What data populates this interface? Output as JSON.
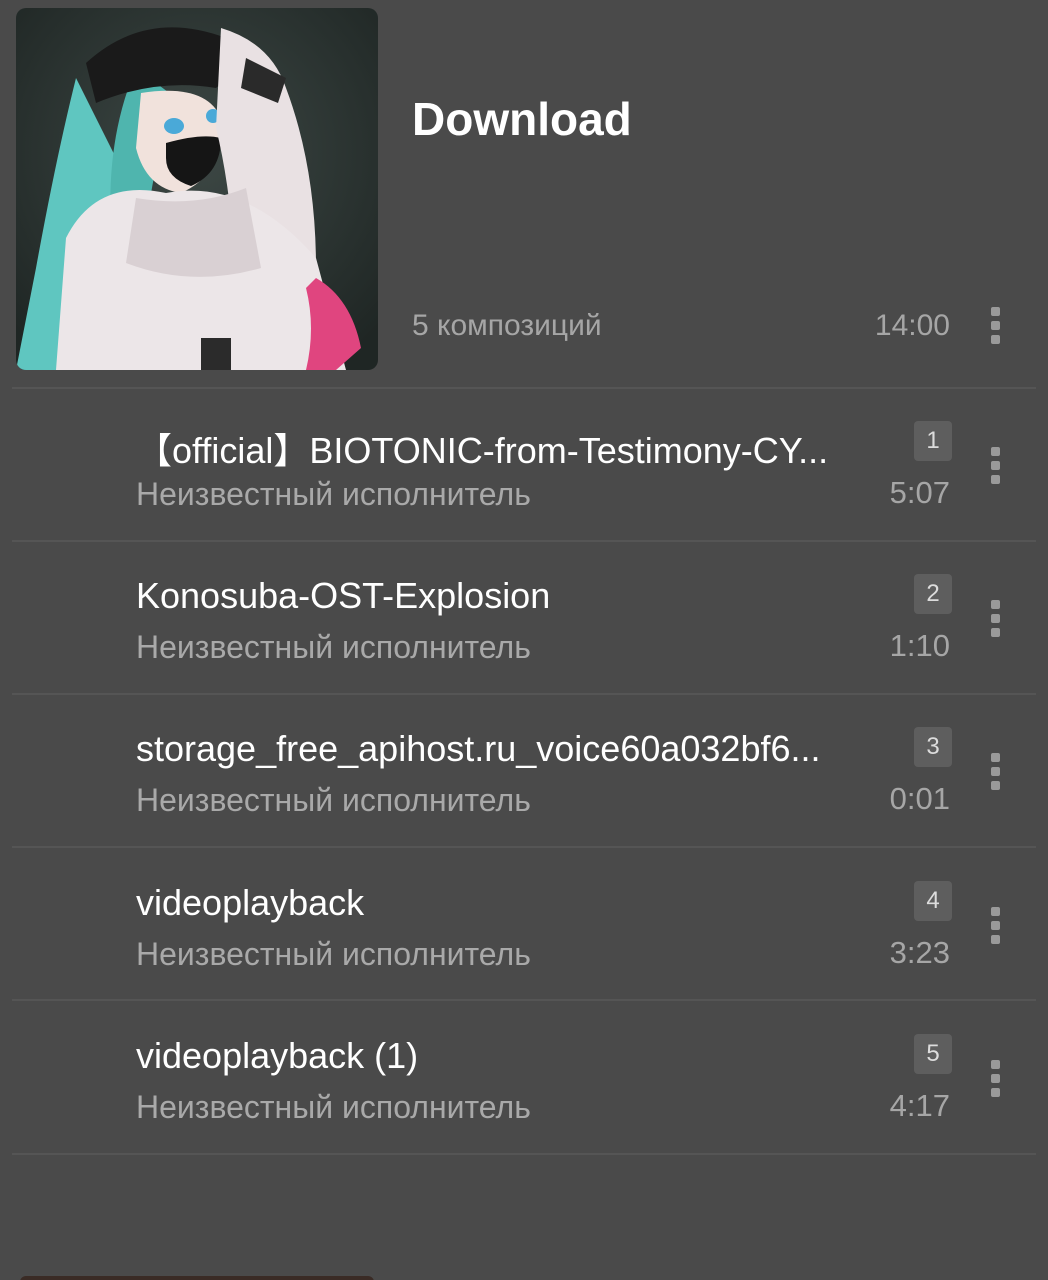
{
  "album": {
    "title": "Download",
    "count_label": "5 композиций",
    "total_duration": "14:00"
  },
  "tracks": [
    {
      "number": "1",
      "title": "【official】BIOTONIC-from-Testimony-CY...",
      "artist": "Неизвестный исполнитель",
      "duration": "5:07"
    },
    {
      "number": "2",
      "title": "Konosuba-OST-Explosion",
      "artist": "Неизвестный исполнитель",
      "duration": "1:10"
    },
    {
      "number": "3",
      "title": "storage_free_apihost.ru_voice60a032bf6...",
      "artist": "Неизвестный исполнитель",
      "duration": "0:01"
    },
    {
      "number": "4",
      "title": "videoplayback",
      "artist": "Неизвестный исполнитель",
      "duration": "3:23"
    },
    {
      "number": "5",
      "title": "videoplayback (1)",
      "artist": "Неизвестный исполнитель",
      "duration": "4:17"
    }
  ],
  "icons": {
    "more": "more-vertical-icon",
    "album_art": "album-art-image"
  },
  "colors": {
    "background": "#4a4a4a",
    "primary_text": "#ffffff",
    "secondary_text": "#a6a6a6",
    "badge": "#5e5e5e"
  }
}
